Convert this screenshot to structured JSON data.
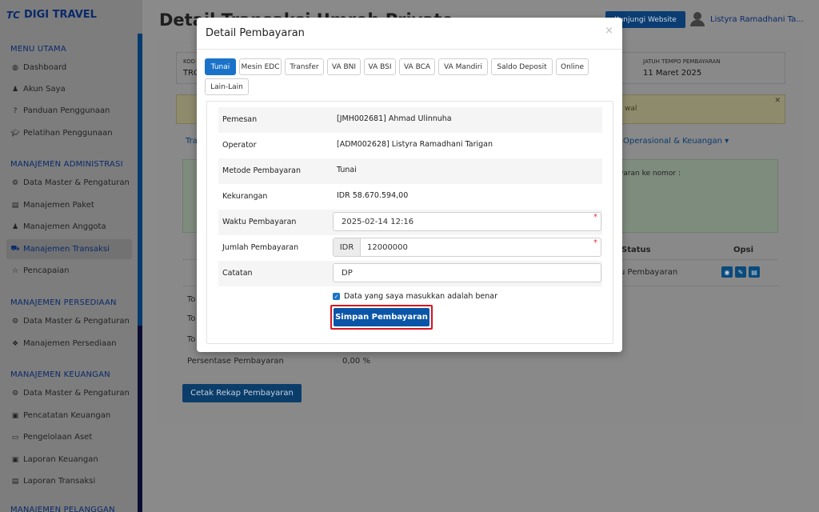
{
  "brand": {
    "mark": "TC",
    "name": "DIGI TRAVEL"
  },
  "sidebar": {
    "sections": [
      {
        "title": "MENU UTAMA",
        "items": [
          {
            "icon": "dashboard-icon",
            "label": "Dashboard"
          },
          {
            "icon": "user-icon",
            "label": "Akun Saya"
          },
          {
            "icon": "help-icon",
            "label": "Panduan Penggunaan"
          },
          {
            "icon": "graduation-cap-icon",
            "label": "Pelatihan Penggunaan"
          }
        ]
      },
      {
        "title": "MANAJEMEN ADMINISTRASI",
        "items": [
          {
            "icon": "gears-icon",
            "label": "Data Master & Pengaturan"
          },
          {
            "icon": "book-icon",
            "label": "Manajemen Paket"
          },
          {
            "icon": "users-icon",
            "label": "Manajemen Anggota"
          },
          {
            "icon": "cart-icon",
            "label": "Manajemen Transaksi",
            "active": true
          },
          {
            "icon": "star-icon",
            "label": "Pencapaian"
          }
        ]
      },
      {
        "title": "MANAJEMEN PERSEDIAAN",
        "items": [
          {
            "icon": "gears-icon",
            "label": "Data Master & Pengaturan"
          },
          {
            "icon": "boxes-icon",
            "label": "Manajemen Persediaan"
          }
        ]
      },
      {
        "title": "MANAJEMEN KEUANGAN",
        "items": [
          {
            "icon": "gears-icon",
            "label": "Data Master & Pengaturan"
          },
          {
            "icon": "money-icon",
            "label": "Pencatatan Keuangan"
          },
          {
            "icon": "monitor-icon",
            "label": "Pengelolaan Aset"
          },
          {
            "icon": "money-icon",
            "label": "Laporan Keuangan"
          },
          {
            "icon": "book-icon",
            "label": "Laporan Transaksi"
          }
        ]
      },
      {
        "title": "MANAJEMEN PELANGGAN",
        "items": []
      }
    ]
  },
  "header": {
    "page_title": "Detail Transaksi Umroh Private",
    "visit_button": "Kunjungi Website",
    "user_name": "Listyra Ramadhani Ta..."
  },
  "background": {
    "code_label": "KOD",
    "code_value": "TRO",
    "due_label": "JATUH TEMPO PEMBAYARAN",
    "due_value": "11 Maret 2025",
    "alert_text": "wal",
    "tab_left": "Tra",
    "tab_right": "Operasional & Keuangan ▾",
    "green_text": "yaran ke nomor :",
    "col_status": "Status",
    "col_opsi": "Opsi",
    "status_value": "u Pembayaran",
    "summary_rows": [
      "To",
      "To",
      "To"
    ],
    "percent_label": "Persentase Pembayaran",
    "percent_value": "0,00 %",
    "rekap_button": "Cetak Rekap Pembayaran"
  },
  "modal": {
    "title": "Detail Pembayaran",
    "close": "×",
    "tabs": [
      "Tunai",
      "Mesin EDC",
      "Transfer",
      "VA BNI",
      "VA BSI",
      "VA BCA",
      "VA Mandiri",
      "Saldo Deposit",
      "Online",
      "Lain-Lain"
    ],
    "active_tab": "Tunai",
    "fields": {
      "pemesan_label": "Pemesan",
      "pemesan_value": "[JMH002681] Ahmad Ulinnuha",
      "operator_label": "Operator",
      "operator_value": "[ADM002628] Listyra Ramadhani Tarigan",
      "metode_label": "Metode Pembayaran",
      "metode_value": "Tunai",
      "kekurangan_label": "Kekurangan",
      "kekurangan_value": "IDR 58.670.594,00",
      "waktu_label": "Waktu Pembayaran",
      "waktu_value": "2025-02-14 12:16",
      "jumlah_label": "Jumlah Pembayaran",
      "jumlah_currency": "IDR",
      "jumlah_value": "12000000",
      "catatan_label": "Catatan",
      "catatan_value": "DP",
      "required_mark": "*"
    },
    "confirm_text": "Data yang saya masukkan adalah benar",
    "confirm_checked": true,
    "save_button": "Simpan Pembayaran"
  },
  "colors": {
    "primary": "#1a73c9",
    "save_button": "#0b55a8",
    "highlight_border": "#d8141f",
    "overlay_sidebar": "#7d7d7d"
  }
}
